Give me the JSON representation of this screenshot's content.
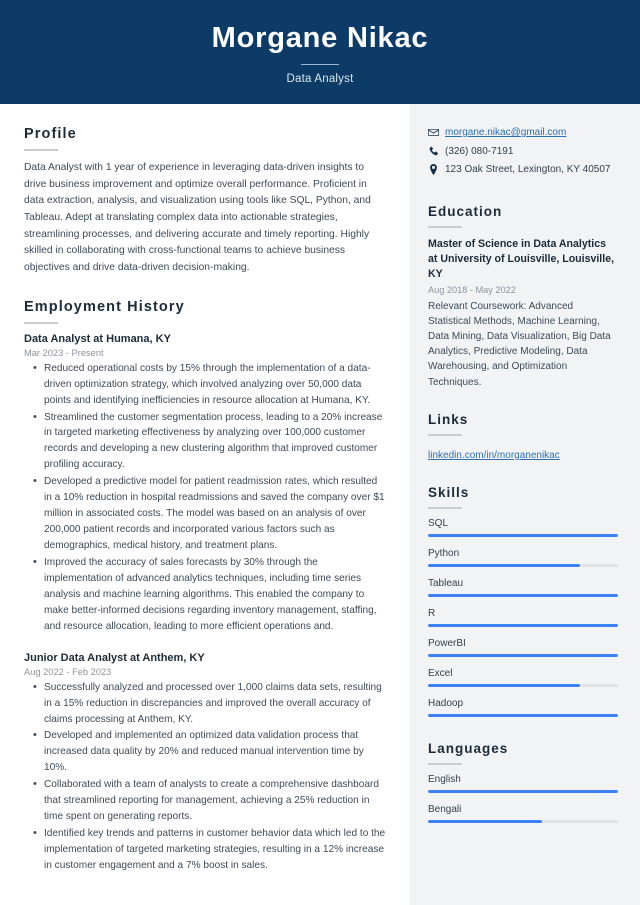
{
  "header": {
    "name": "Morgane Nikac",
    "job_title": "Data Analyst"
  },
  "main": {
    "profile": {
      "heading": "Profile",
      "text": "Data Analyst with 1 year of experience in leveraging data-driven insights to drive business improvement and optimize overall performance. Proficient in data extraction, analysis, and visualization using tools like SQL, Python, and Tableau. Adept at translating complex data into actionable strategies, streamlining processes, and delivering accurate and timely reporting. Highly skilled in collaborating with cross-functional teams to achieve business objectives and drive data-driven decision-making."
    },
    "employment": {
      "heading": "Employment History",
      "jobs": [
        {
          "title": "Data Analyst at Humana, KY",
          "date": "Mar 2023 - Present",
          "bullets": [
            "Reduced operational costs by 15% through the implementation of a data-driven optimization strategy, which involved analyzing over 50,000 data points and identifying inefficiencies in resource allocation at Humana, KY.",
            "Streamlined the customer segmentation process, leading to a 20% increase in targeted marketing effectiveness by analyzing over 100,000 customer records and developing a new clustering algorithm that improved customer profiling accuracy.",
            "Developed a predictive model for patient readmission rates, which resulted in a 10% reduction in hospital readmissions and saved the company over $1 million in associated costs. The model was based on an analysis of over 200,000 patient records and incorporated various factors such as demographics, medical history, and treatment plans.",
            "Improved the accuracy of sales forecasts by 30% through the implementation of advanced analytics techniques, including time series analysis and machine learning algorithms. This enabled the company to make better-informed decisions regarding inventory management, staffing, and resource allocation, leading to more efficient operations and."
          ]
        },
        {
          "title": "Junior Data Analyst at Anthem, KY",
          "date": "Aug 2022 - Feb 2023",
          "bullets": [
            "Successfully analyzed and processed over 1,000 claims data sets, resulting in a 15% reduction in discrepancies and improved the overall accuracy of claims processing at Anthem, KY.",
            "Developed and implemented an optimized data validation process that increased data quality by 20% and reduced manual intervention time by 10%.",
            "Collaborated with a team of analysts to create a comprehensive dashboard that streamlined reporting for management, achieving a 25% reduction in time spent on generating reports.",
            "Identified key trends and patterns in customer behavior data which led to the implementation of targeted marketing strategies, resulting in a 12% increase in customer engagement and a 7% boost in sales."
          ]
        }
      ]
    }
  },
  "sidebar": {
    "contact": [
      {
        "icon": "envelope-icon",
        "value": "morgane.nikac@gmail.com",
        "is_link": true
      },
      {
        "icon": "phone-icon",
        "value": "(326) 080-7191",
        "is_link": false
      },
      {
        "icon": "location-pin-icon",
        "value": "123 Oak Street, Lexington, KY 40507",
        "is_link": false
      }
    ],
    "education": {
      "heading": "Education",
      "degree": "Master of Science in Data Analytics at University of Louisville, Louisville, KY",
      "date": "Aug 2018 - May 2022",
      "description": "Relevant Coursework: Advanced Statistical Methods, Machine Learning, Data Mining, Data Visualization, Big Data Analytics, Predictive Modeling, Data Warehousing, and Optimization Techniques."
    },
    "links": {
      "heading": "Links",
      "items": [
        {
          "label": "linkedin.com/in/morganenikac"
        }
      ]
    },
    "skills": {
      "heading": "Skills",
      "items": [
        {
          "label": "SQL",
          "level": 100
        },
        {
          "label": "Python",
          "level": 80
        },
        {
          "label": "Tableau",
          "level": 100
        },
        {
          "label": "R",
          "level": 100
        },
        {
          "label": "PowerBI",
          "level": 100
        },
        {
          "label": "Excel",
          "level": 80
        },
        {
          "label": "Hadoop",
          "level": 100
        }
      ]
    },
    "languages": {
      "heading": "Languages",
      "items": [
        {
          "label": "English",
          "level": 100
        },
        {
          "label": "Bengali",
          "level": 60
        }
      ]
    }
  },
  "colors": {
    "header_bg": "#0b3b66",
    "sidebar_bg": "#f2f3f5",
    "accent_bar": "#3b82f6",
    "link": "#2b6fb8",
    "body_text": "#3c4b5a"
  }
}
